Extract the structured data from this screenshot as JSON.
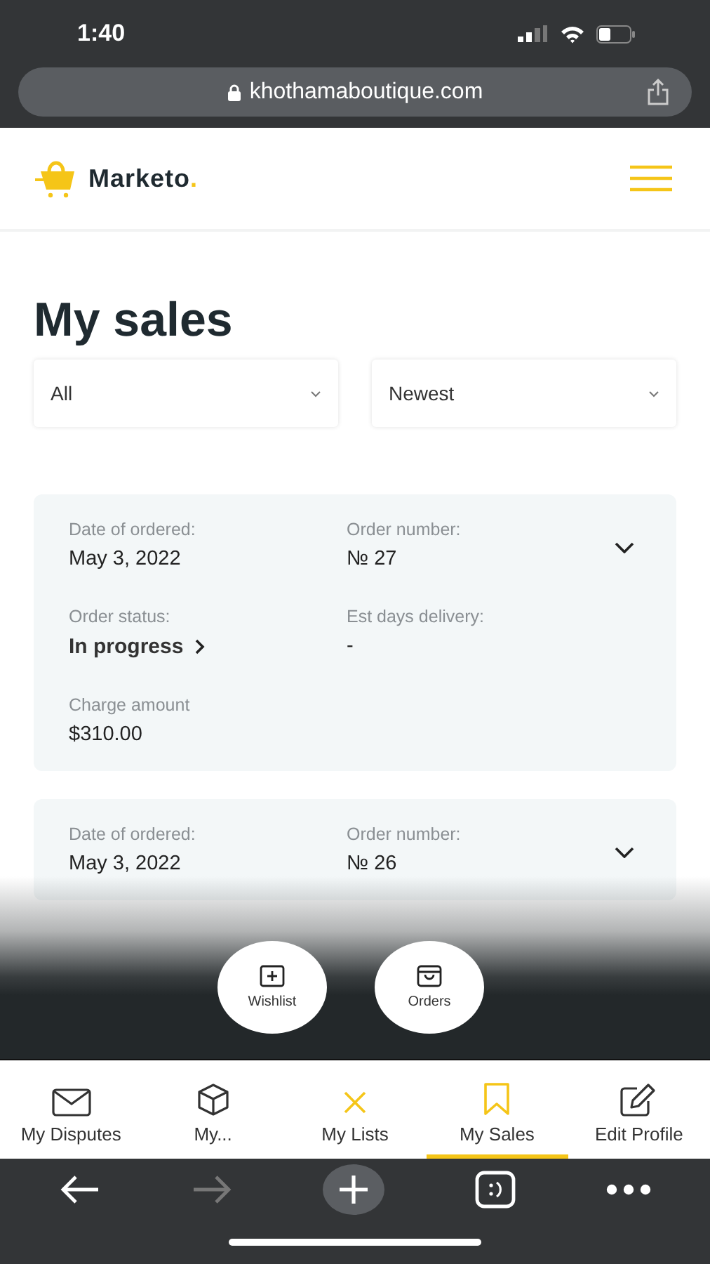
{
  "status_bar": {
    "time": "1:40"
  },
  "browser": {
    "url": "khothamaboutique.com",
    "forward_disabled": true
  },
  "header": {
    "logo": {
      "name": "Marketo",
      "mark": "."
    }
  },
  "page": {
    "title": "My sales"
  },
  "filters": [
    {
      "value": "All"
    },
    {
      "value": "Newest"
    }
  ],
  "orders": [
    {
      "fields": [
        {
          "label": "Date of ordered:",
          "value": "May 3, 2022"
        },
        {
          "label": "Order number:",
          "value": "№ 27"
        },
        {
          "label": "Order status:",
          "value": "In progress",
          "kind": "link"
        },
        {
          "label": "Est days delivery:",
          "value": "-"
        },
        {
          "label": "Charge amount",
          "value": "$310.00"
        }
      ]
    },
    {
      "fields": [
        {
          "label": "Date of ordered:",
          "value": "May 3, 2022"
        },
        {
          "label": "Order number:",
          "value": "№ 26"
        }
      ]
    }
  ],
  "quick_actions": [
    {
      "label": "Wishlist",
      "kind": "plus-square"
    },
    {
      "label": "Orders",
      "kind": "bag"
    }
  ],
  "tabs": [
    {
      "label": "My Disputes",
      "kind": "envelope",
      "selected": false
    },
    {
      "label": "My...",
      "kind": "cube",
      "selected": false
    },
    {
      "label": "My Lists",
      "kind": "cross",
      "selected": false
    },
    {
      "label": "My Sales",
      "kind": "bookmark",
      "selected": true
    },
    {
      "label": "Edit Profile",
      "kind": "pencil",
      "selected": false
    }
  ]
}
